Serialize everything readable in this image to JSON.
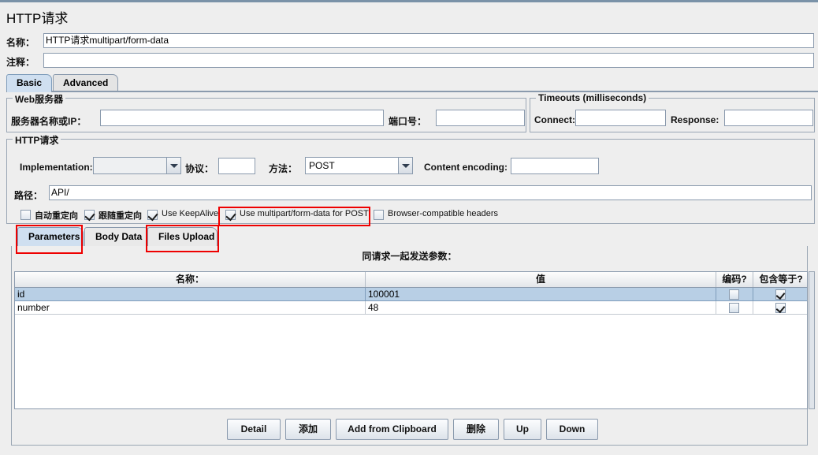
{
  "window": {
    "title": "HTTP请求"
  },
  "header": {
    "name_label": "名称：",
    "name_value": "HTTP请求multipart/form-data",
    "comment_label": "注释：",
    "comment_value": ""
  },
  "main_tabs": [
    {
      "label": "Basic",
      "selected": true
    },
    {
      "label": "Advanced",
      "selected": false
    }
  ],
  "web_server": {
    "group_title": "Web服务器",
    "server_label": "服务器名称或IP：",
    "server_value": "",
    "port_label": "端口号：",
    "port_value": ""
  },
  "timeouts": {
    "group_title": "Timeouts (milliseconds)",
    "connect_label": "Connect:",
    "connect_value": "",
    "response_label": "Response:",
    "response_value": ""
  },
  "http_request": {
    "group_title": "HTTP请求",
    "implementation_label": "Implementation:",
    "implementation_value": "",
    "protocol_label": "协议：",
    "protocol_value": "",
    "method_label": "方法：",
    "method_value": "POST",
    "content_encoding_label": "Content encoding:",
    "content_encoding_value": "",
    "path_label": "路径：",
    "path_value": "API/",
    "checkboxes": [
      {
        "label": "自动重定向",
        "checked": false,
        "cjk": true
      },
      {
        "label": "跟随重定向",
        "checked": true,
        "cjk": true
      },
      {
        "label": "Use KeepAlive",
        "checked": true,
        "cjk": false
      },
      {
        "label": "Use multipart/form-data for POST",
        "checked": true,
        "cjk": false
      },
      {
        "label": "Browser-compatible headers",
        "checked": false,
        "cjk": false
      }
    ]
  },
  "sub_tabs": [
    {
      "label": "Parameters",
      "selected": true
    },
    {
      "label": "Body Data",
      "selected": false
    },
    {
      "label": "Files Upload",
      "selected": false
    }
  ],
  "parameters_panel": {
    "send_with_request_label": "同请求一起发送参数：",
    "columns": [
      "名称：",
      "值",
      "编码?",
      "包含等于?"
    ],
    "rows": [
      {
        "name": "id",
        "value": "100001",
        "encode": false,
        "include_equals": true,
        "selected": true
      },
      {
        "name": "number",
        "value": "48",
        "encode": false,
        "include_equals": true,
        "selected": false
      }
    ],
    "buttons": [
      "Detail",
      "添加",
      "Add from Clipboard",
      "删除",
      "Up",
      "Down"
    ]
  },
  "annotations": {
    "highlight_color": "#ee0000",
    "boxes": [
      "use-multipart-checkbox",
      "parameters-tab",
      "files-upload-tab"
    ]
  }
}
